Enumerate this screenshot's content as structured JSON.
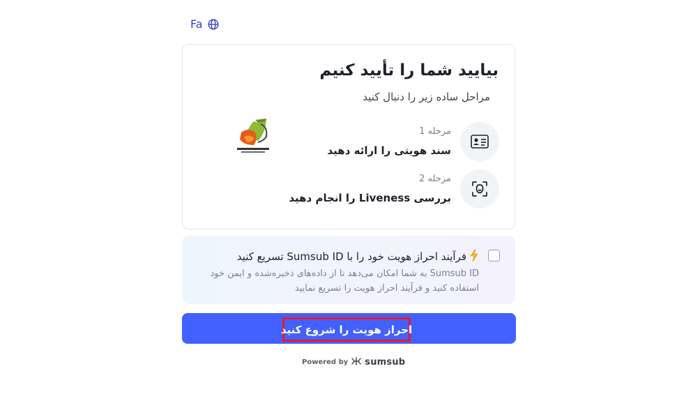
{
  "language": {
    "label": "Fa",
    "icon": "globe-icon"
  },
  "card": {
    "title": "بیایید شما را تأیید کنیم",
    "subtitle": "مراحل ساده زیر را دنبال کنید",
    "logo_icon": "company-logo",
    "steps": [
      {
        "label": "مرحله 1",
        "text": "سند هویتی را ارائه دهید",
        "icon": "id-card-icon"
      },
      {
        "label": "مرحله 2",
        "text": "بررسی Liveness را انجام دهید",
        "icon": "face-scan-icon"
      }
    ]
  },
  "sumsub_id": {
    "title": "فرآیند احراز هویت خود را با Sumsub ID تسریع کنید",
    "description": "Sumsub ID به شما امکان می‌دهد تا از داده‌های ذخیره‌شده و ایمن خود استفاده کنید و فرآیند احراز هویت را تسریع نمایید",
    "icon": "lightning-icon",
    "checked": false
  },
  "start_button": {
    "label": "احراز هویت را شروع کنید"
  },
  "footer": {
    "powered_by": "Powered by",
    "brand": "sumsub",
    "brand_icon": "sumsub-logo-icon"
  },
  "colors": {
    "accent": "#4361ff",
    "highlight": "#e8192c",
    "link": "#3b3fd0"
  }
}
